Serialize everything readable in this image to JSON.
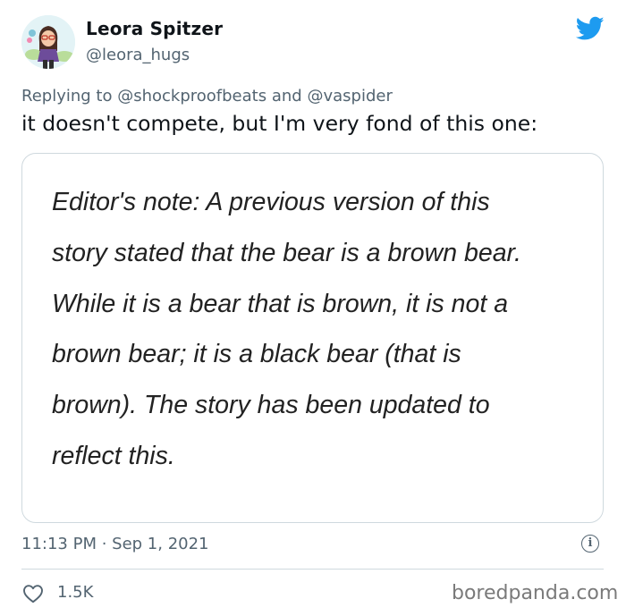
{
  "author": {
    "display_name": "Leora Spitzer",
    "handle": "@leora_hugs"
  },
  "reply_context": {
    "prefix": "Replying to",
    "mention_1": "@shockproofbeats",
    "conjunction": "and",
    "mention_2": "@vaspider"
  },
  "tweet": {
    "text": "it doesn't compete, but I'm very fond of this one:",
    "image_lines": [
      "Editor's note: A previous version of this",
      "story stated that the bear is a brown bear.",
      "While it is a bear that is brown, it is not a",
      "brown bear; it is a black bear (that is",
      "brown). The story has been updated to",
      "reflect this."
    ],
    "timestamp": "11:13 PM · Sep 1, 2021",
    "likes": "1.5K"
  },
  "icons": {
    "brand": "twitter-bird-icon",
    "info": "info-icon",
    "like": "heart-icon"
  },
  "colors": {
    "twitter_blue": "#1d9bf0",
    "secondary_text": "#536471",
    "border": "#cfd9de"
  },
  "watermark": "boredpanda.com"
}
